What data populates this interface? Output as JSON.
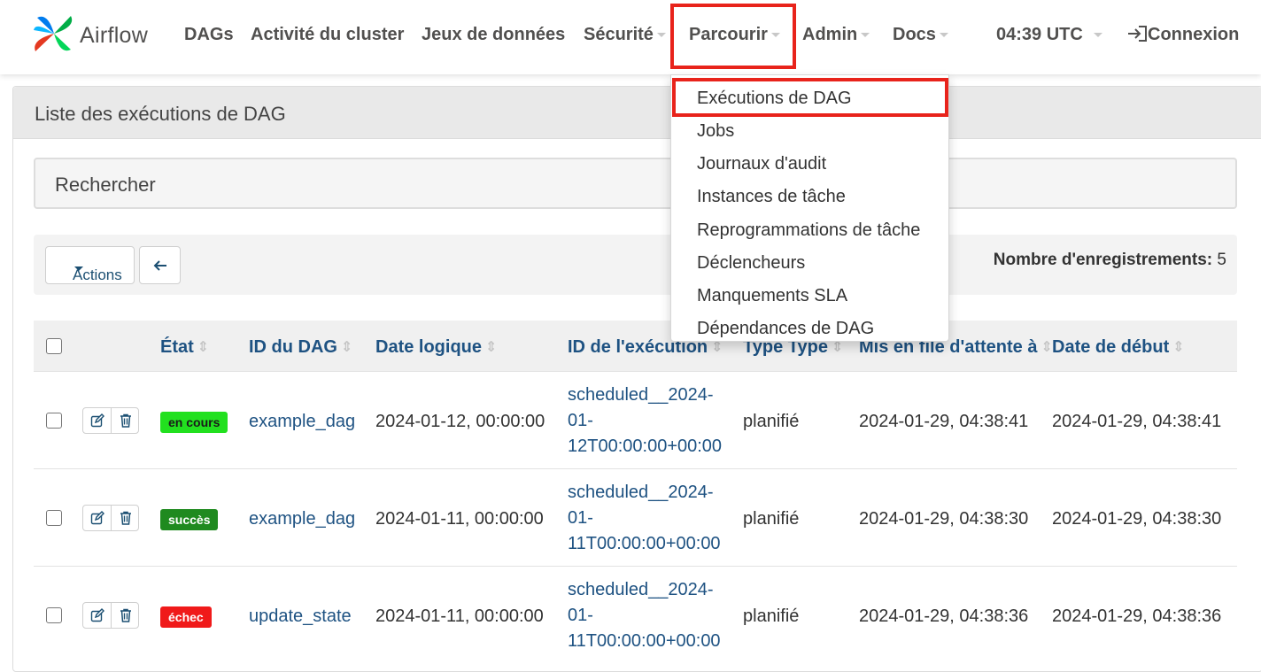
{
  "navbar": {
    "brand": "Airflow",
    "items": [
      {
        "label": "DAGs"
      },
      {
        "label": "Activité du cluster"
      },
      {
        "label": "Jeux de données"
      },
      {
        "label": "Sécurité"
      },
      {
        "label": "Parcourir"
      },
      {
        "label": "Admin"
      },
      {
        "label": "Docs"
      }
    ],
    "time": "04:39 UTC",
    "login": "Connexion"
  },
  "browse_menu": {
    "items": [
      {
        "label": "Exécutions de DAG"
      },
      {
        "label": "Jobs"
      },
      {
        "label": "Journaux d'audit"
      },
      {
        "label": "Instances de tâche"
      },
      {
        "label": "Reprogrammations de tâche"
      },
      {
        "label": "Déclencheurs"
      },
      {
        "label": "Manquements SLA"
      },
      {
        "label": "Dépendances de DAG"
      }
    ]
  },
  "colors": {
    "highlight": "#e8231b",
    "link": "#1e5282",
    "running": "#22e01f",
    "success": "#1f8a1f",
    "failed": "#f01a1a"
  },
  "panel": {
    "title": "Liste des exécutions de DAG",
    "search_label": "Rechercher",
    "actions_label": "Actions",
    "record_count_label": "Nombre d'enregistrements:",
    "record_count": "5"
  },
  "table": {
    "columns": {
      "state": "État",
      "dag_id": "ID du DAG",
      "logical_date": "Date logique",
      "run_id": "ID de l'exécution",
      "run_type": "Type Type",
      "queued_at": "Mis en file d'attente à",
      "start_date": "Date de début"
    },
    "rows": [
      {
        "state": "en cours",
        "state_color": "#22e01f",
        "dag_id": "example_dag",
        "logical_date": "2024-01-12, 00:00:00",
        "run_id_1": "scheduled__2024-",
        "run_id_2": "01-",
        "run_id_3": "12T00:00:00+00:00",
        "run_type": "planifié",
        "queued_at": "2024-01-29, 04:38:41",
        "start_date": "2024-01-29, 04:38:41"
      },
      {
        "state": "succès",
        "state_color": "#1f8a1f",
        "dag_id": "example_dag",
        "logical_date": "2024-01-11, 00:00:00",
        "run_id_1": "scheduled__2024-",
        "run_id_2": "01-",
        "run_id_3": "11T00:00:00+00:00",
        "run_type": "planifié",
        "queued_at": "2024-01-29, 04:38:30",
        "start_date": "2024-01-29, 04:38:30"
      },
      {
        "state": "échec",
        "state_color": "#f01a1a",
        "dag_id": "update_state",
        "logical_date": "2024-01-11, 00:00:00",
        "run_id_1": "scheduled__2024-",
        "run_id_2": "01-",
        "run_id_3": "11T00:00:00+00:00",
        "run_type": "planifié",
        "queued_at": "2024-01-29, 04:38:36",
        "start_date": "2024-01-29, 04:38:36"
      }
    ]
  }
}
